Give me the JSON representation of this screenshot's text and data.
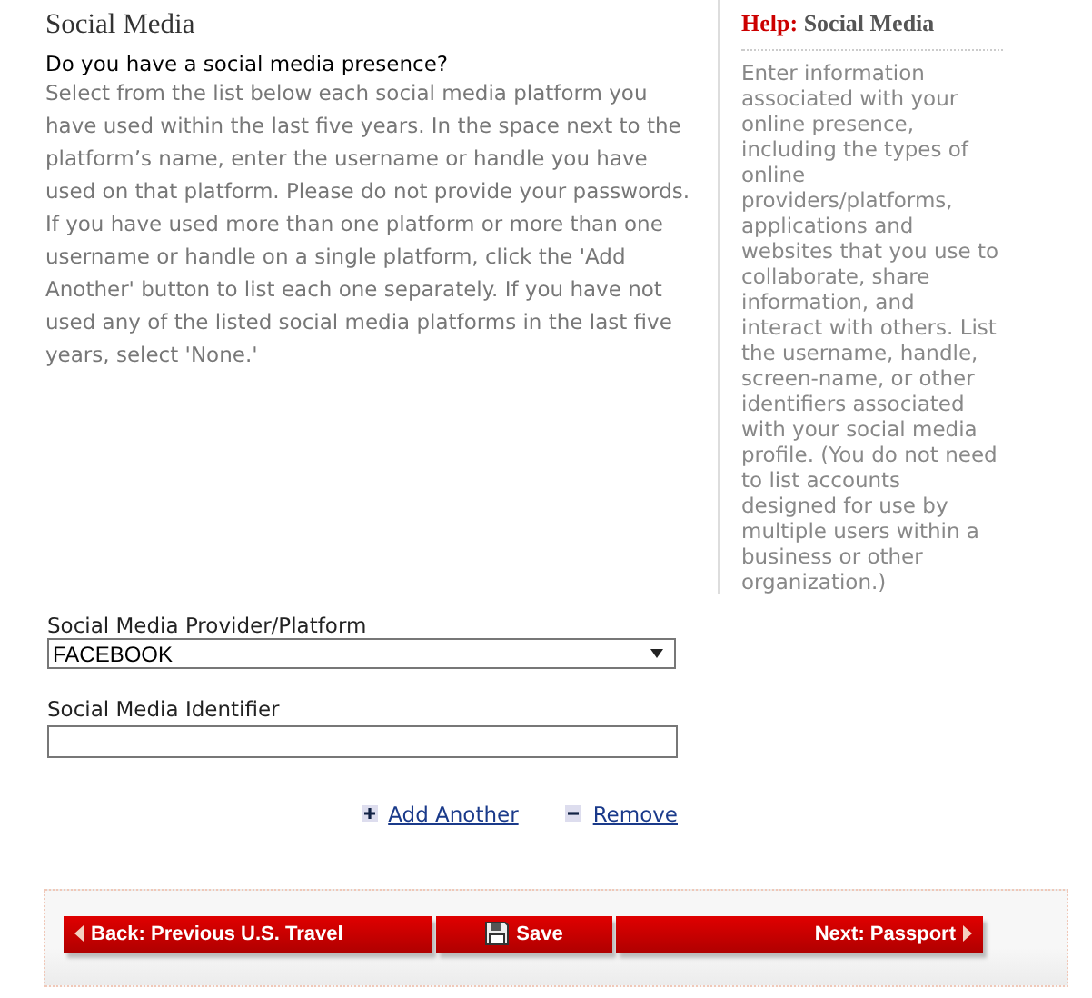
{
  "section": {
    "title": "Social Media",
    "question": "Do you have a social media presence?",
    "instructions": "Select from the list below each social media platform you have used within the last five years. In the space next to the platform’s name, enter the username or handle you have used on that platform. Please do not provide your passwords. If you have used more than one platform or more than one username or handle on a single platform, click the 'Add Another' button to list each one separately. If you have not used any of the listed social media platforms in the last five years, select 'None.'"
  },
  "help": {
    "label": "Help:",
    "title": "Social Media",
    "text": "Enter information associated with your online presence, including the types of online providers/platforms, applications and websites that you use to collaborate, share information, and interact with others. List the username, handle, screen-name, or other identifiers associated with your social media profile. (You do not need to list accounts designed for use by multiple users within a business or other organization.)"
  },
  "form": {
    "platform": {
      "label": "Social Media Provider/Platform",
      "value": "FACEBOOK"
    },
    "identifier": {
      "label": "Social Media Identifier"
    },
    "actions": [
      {
        "kind": "add",
        "label": "Add Another"
      },
      {
        "kind": "remove",
        "label": "Remove"
      }
    ]
  },
  "navigation": [
    {
      "kind": "back",
      "label": "Back: Previous U.S. Travel"
    },
    {
      "kind": "save",
      "label": "Save"
    },
    {
      "kind": "next",
      "label": "Next: Passport"
    }
  ]
}
